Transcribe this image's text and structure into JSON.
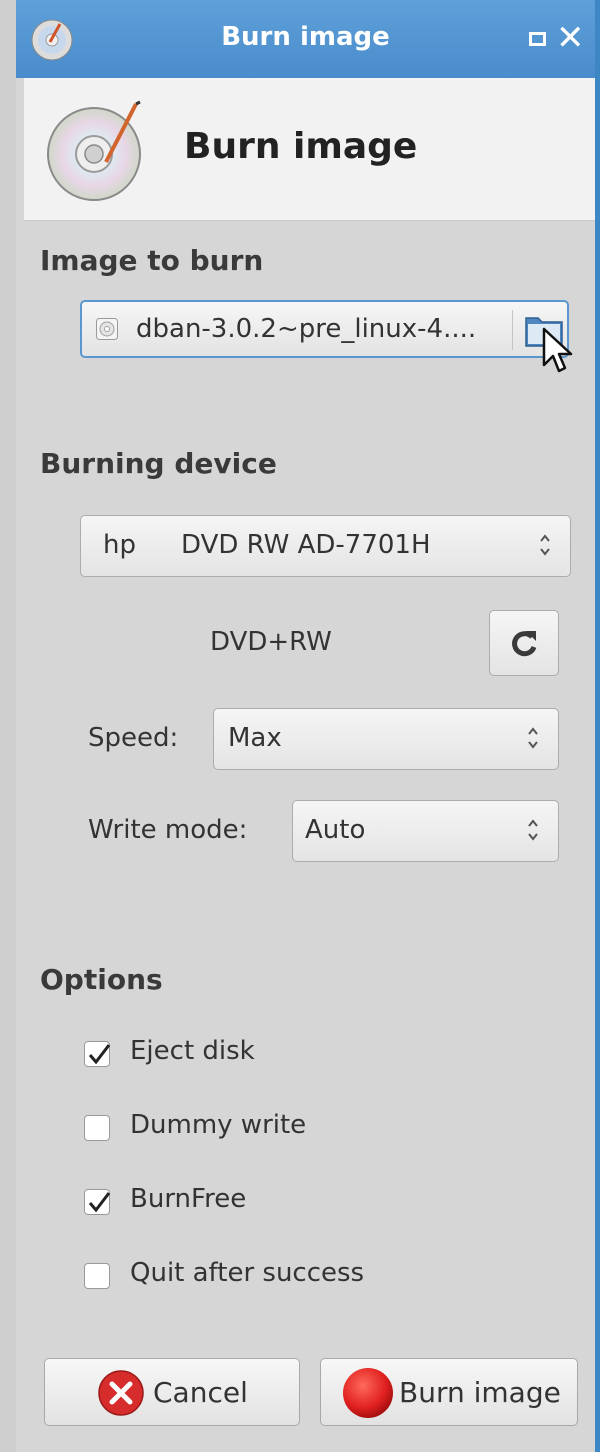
{
  "window": {
    "title": "Burn image"
  },
  "header": {
    "title": "Burn image"
  },
  "image_section": {
    "heading": "Image to burn",
    "file_name": "dban-3.0.2~pre_linux-4...."
  },
  "device_section": {
    "heading": "Burning device",
    "drive_vendor": "hp",
    "drive_model": "DVD RW AD-7701H",
    "disc_type": "DVD+RW",
    "speed_label": "Speed:",
    "speed_value": "Max",
    "write_mode_label": "Write mode:",
    "write_mode_value": "Auto"
  },
  "options_section": {
    "heading": "Options",
    "items": [
      {
        "label": "Eject disk",
        "checked": true
      },
      {
        "label": "Dummy write",
        "checked": false
      },
      {
        "label": "BurnFree",
        "checked": true
      },
      {
        "label": "Quit after success",
        "checked": false
      }
    ]
  },
  "buttons": {
    "cancel": "Cancel",
    "burn": "Burn image"
  },
  "colors": {
    "titlebar": "#4a8ccb",
    "accent_border": "#5b97cf",
    "cancel_icon": "#d62c2c",
    "burn_icon": "#e02020"
  }
}
